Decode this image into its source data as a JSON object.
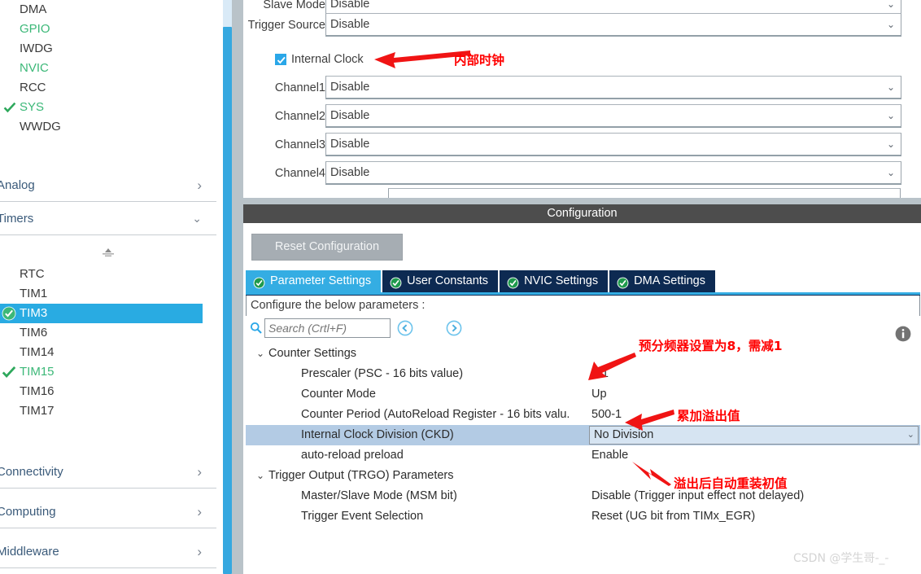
{
  "sidebar": {
    "peripherals": [
      {
        "label": "DMA",
        "checked": false,
        "active": false
      },
      {
        "label": "GPIO",
        "checked": false,
        "active": true
      },
      {
        "label": "IWDG",
        "checked": false,
        "active": false
      },
      {
        "label": "NVIC",
        "checked": false,
        "active": true
      },
      {
        "label": "RCC",
        "checked": false,
        "active": false
      },
      {
        "label": "SYS",
        "checked": true,
        "active": true
      },
      {
        "label": "WWDG",
        "checked": false,
        "active": false
      }
    ],
    "groups": {
      "analog": {
        "label": "Analog",
        "icon": "chevron-right-icon",
        "expanded": false
      },
      "timers": {
        "label": "Timers",
        "icon": "chevron-down-icon",
        "expanded": true
      },
      "connectivity": {
        "label": "Connectivity",
        "icon": "chevron-right-icon",
        "expanded": false
      },
      "computing": {
        "label": "Computing",
        "icon": "chevron-right-icon",
        "expanded": false
      },
      "middleware": {
        "label": "Middleware",
        "icon": "chevron-right-icon",
        "expanded": false
      }
    },
    "timers": [
      {
        "label": "RTC",
        "checked": false,
        "active": false,
        "selected": false
      },
      {
        "label": "TIM1",
        "checked": false,
        "active": false,
        "selected": false
      },
      {
        "label": "TIM3",
        "checked": true,
        "active": false,
        "selected": true
      },
      {
        "label": "TIM6",
        "checked": false,
        "active": false,
        "selected": false
      },
      {
        "label": "TIM14",
        "checked": false,
        "active": false,
        "selected": false
      },
      {
        "label": "TIM15",
        "checked": true,
        "active": true,
        "selected": false
      },
      {
        "label": "TIM16",
        "checked": false,
        "active": false,
        "selected": false
      },
      {
        "label": "TIM17",
        "checked": false,
        "active": false,
        "selected": false
      }
    ]
  },
  "mode_form": {
    "rows": [
      {
        "label": "Slave Mode",
        "value": "Disable"
      },
      {
        "label": "Trigger Source",
        "value": "Disable"
      },
      {
        "label": "Channel1",
        "value": "Disable"
      },
      {
        "label": "Channel2",
        "value": "Disable"
      },
      {
        "label": "Channel3",
        "value": "Disable"
      },
      {
        "label": "Channel4",
        "value": "Disable"
      }
    ],
    "internal_clock": {
      "label": "Internal Clock",
      "checked": true
    }
  },
  "configuration": {
    "title": "Configuration",
    "reset_button": "Reset Configuration",
    "tabs": [
      {
        "label": "Parameter Settings",
        "active": true
      },
      {
        "label": "User Constants",
        "active": false
      },
      {
        "label": "NVIC Settings",
        "active": false
      },
      {
        "label": "DMA Settings",
        "active": false
      }
    ],
    "subtitle": "Configure the below parameters :",
    "search": {
      "placeholder": "Search (Crtl+F)",
      "value": ""
    },
    "nav": {
      "prev": "collapse-all-icon",
      "next": "expand-all-icon"
    }
  },
  "parameters": [
    {
      "kind": "group",
      "name": "Counter Settings",
      "value": "",
      "caret": "chevron-down-icon"
    },
    {
      "kind": "leaf",
      "name": "Prescaler (PSC - 16 bits value)",
      "value": "8-1"
    },
    {
      "kind": "leaf",
      "name": "Counter Mode",
      "value": "Up"
    },
    {
      "kind": "leaf",
      "name": "Counter Period (AutoReload Register - 16 bits valu.",
      "value": "500-1",
      "clipped": true
    },
    {
      "kind": "editing",
      "name": "Internal Clock Division (CKD)",
      "value": "No Division"
    },
    {
      "kind": "leaf",
      "name": "auto-reload preload",
      "value": "Enable"
    },
    {
      "kind": "group",
      "name": "Trigger Output (TRGO) Parameters",
      "value": "",
      "caret": "chevron-down-icon"
    },
    {
      "kind": "leaf",
      "name": "Master/Slave Mode (MSM bit)",
      "value": "Disable (Trigger input effect not delayed)"
    },
    {
      "kind": "leaf",
      "name": "Trigger Event Selection",
      "value": "Reset (UG bit from TIMx_EGR)"
    }
  ],
  "annotations": [
    {
      "id": "internal-clock-note",
      "text": "内部时钟"
    },
    {
      "id": "prescaler-note",
      "text": "预分频器设置为8，需减1"
    },
    {
      "id": "period-note",
      "text": "累加溢出值"
    },
    {
      "id": "preload-note",
      "text": "溢出后自动重装初值"
    }
  ],
  "watermark": "CSDN @学生哥-_-",
  "colors": {
    "accent": "#29abe2",
    "tab_active": "#34ade3",
    "tab_inactive": "#0d2a52",
    "annotation": "#ff0000",
    "green": "#3cb878",
    "row_highlight": "#b3cbe4",
    "config_header": "#4d4d4d"
  }
}
